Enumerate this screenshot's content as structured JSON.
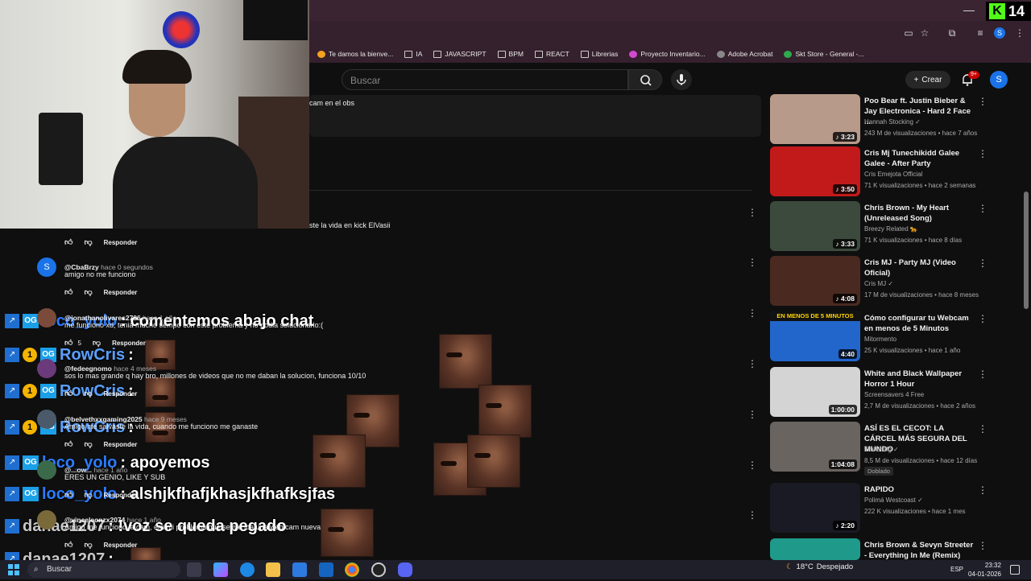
{
  "kick": {
    "viewer_count": "14",
    "logo_letter": "K"
  },
  "browser": {
    "minimize_glyph": "—",
    "bookmarks": [
      {
        "label": "Te damos la bienve...",
        "icon": "orange-logo-icon"
      },
      {
        "label": "IA",
        "icon": "folder-icon"
      },
      {
        "label": "JAVASCRIPT",
        "icon": "folder-icon"
      },
      {
        "label": "BPM",
        "icon": "folder-icon"
      },
      {
        "label": "REACT",
        "icon": "folder-icon"
      },
      {
        "label": "Librerias",
        "icon": "folder-icon"
      },
      {
        "label": "Proyecto Inventario...",
        "icon": "app-icon"
      },
      {
        "label": "Adobe Acrobat",
        "icon": "acrobat-icon"
      },
      {
        "label": "Skt Store - General -...",
        "icon": "store-icon"
      }
    ],
    "profile_letter": "S"
  },
  "youtube": {
    "search_placeholder": "Buscar",
    "create_label": "Crear",
    "notification_badge": "9+",
    "avatar_letter": "S"
  },
  "comments": {
    "top_snippet": "cam en el obs",
    "snippet2": "ste la vida en kick ElVasii",
    "reply_label": "Responder",
    "items": [
      {
        "user": "@CbaBrzy",
        "time": "hace 0 segundos",
        "text": "amigo no me funciono",
        "avatar_letter": "S",
        "likes": ""
      },
      {
        "user": "@jonathanolivares2706",
        "time": "hace 1 año",
        "text": "me funciono xd, tenia mucho tiempo con este problema y no podia solucionarlo:(",
        "likes": "5"
      },
      {
        "user": "@fedeegnomo",
        "time": "hace 4 meses",
        "text": "sos lo mas grande q hay bro, millones de videos que no me daban la solucion, funciona 10/10",
        "likes": ""
      },
      {
        "user": "@belvethxxgaming2025",
        "time": "hace 9 meses",
        "text": "Amigo me salvaste la vida, cuando me funciono me ganaste",
        "likes": ""
      },
      {
        "user": "@...ow...",
        "time": "hace 1 año",
        "text": "ERES UN GENIO, LIKE Y SUB",
        "likes": ""
      },
      {
        "user": "@vinceleonzx2074",
        "time": "hace 1 año",
        "text": "Amigo me funciono la cam, era mi problema que se me iba una web cam nueva",
        "likes": ""
      }
    ]
  },
  "chat": [
    {
      "name": "loco_yolo",
      "msg": ": comentemos abajo chat",
      "name_color": "#2b7cff",
      "badges": [
        "kick",
        "og"
      ]
    },
    {
      "name": "RowCris",
      "msg": ":",
      "name_color": "#5aa0ff",
      "badges": [
        "kick",
        "one",
        "og"
      ]
    },
    {
      "name": "RowCris",
      "msg": ":",
      "name_color": "#5aa0ff",
      "badges": [
        "kick",
        "one",
        "og"
      ]
    },
    {
      "name": "RowCris",
      "msg": ":",
      "name_color": "#5aa0ff",
      "badges": [
        "kick",
        "one",
        "og"
      ]
    },
    {
      "name": "loco_yolo",
      "msg": ": apoyemos",
      "name_color": "#2b7cff",
      "badges": [
        "kick",
        "og"
      ]
    },
    {
      "name": "loco_yolo",
      "msg": ": alshjkfhafjkhasjkfhafksjfas",
      "name_color": "#2b7cff",
      "badges": [
        "kick",
        "og"
      ]
    },
    {
      "name": "danae1207",
      "msg": ": !voz se queda pegado",
      "name_color": "#c8c8c8",
      "badges": [
        "kick"
      ]
    },
    {
      "name": "danae1207",
      "msg": ":",
      "name_color": "#c8c8c8",
      "badges": [
        "kick"
      ]
    }
  ],
  "sidebar": {
    "videos": [
      {
        "title": "Poo Bear ft. Justin Bieber & Jay Electronica - Hard 2 Face ...",
        "channel": "Hannah Stocking ✓",
        "meta": "243 M de visualizaciones • hace 7 años",
        "duration": "♪ 3:23",
        "thumb": "#b89a8a"
      },
      {
        "title": "Cris Mj Tunechikidd Galee Galee - After Party",
        "channel": "Cris Emejota Official",
        "meta": "71 K visualizaciones • hace 2 semanas",
        "duration": "♪ 3:50",
        "thumb": "#c21a1a"
      },
      {
        "title": "Chris Brown - My Heart (Unreleased Song)",
        "channel": "Breezy Related 🐆",
        "meta": "71 K visualizaciones • hace 8 días",
        "duration": "♪ 3:33",
        "thumb": "#3c4a3e"
      },
      {
        "title": "Cris MJ - Party MJ (Video Oficial)",
        "channel": "Cris MJ ✓",
        "meta": "17 M de visualizaciones • hace 8 meses",
        "duration": "♪ 4:08",
        "thumb": "#4a2a20"
      },
      {
        "title": "Cómo configurar tu Webcam en menos de 5 Minutos",
        "channel": "Mitormento",
        "meta": "25 K visualizaciones • hace 1 año",
        "duration": "4:40",
        "thumb": "#2266cc",
        "overlay": "EN MENOS DE 5 MINUTOS"
      },
      {
        "title": "White and Black Wallpaper Horror 1 Hour",
        "channel": "Screensavers 4 Free",
        "meta": "2,7 M de visualizaciones • hace 2 años",
        "duration": "1:00:00",
        "thumb": "#d4d4d4"
      },
      {
        "title": "ASÍ ES EL CECOT: LA CÁRCEL MÁS SEGURA DEL MUNDO",
        "channel": "TheGrefg ✓",
        "meta": "8,5 M de visualizaciones • hace 12 días",
        "duration": "1:04:08",
        "thumb": "#6a6460",
        "tag": "Doblado"
      },
      {
        "title": "RAPIDO",
        "channel": "Polimá Westcoast ✓",
        "meta": "222 K visualizaciones • hace 1 mes",
        "duration": "♪ 2:20",
        "thumb": "#1a1a24"
      },
      {
        "title": "Chris Brown & Sevyn Streeter - Everything In Me (Remix)",
        "channel": "",
        "meta": "",
        "duration": "",
        "thumb": "#1f9a8a"
      }
    ]
  },
  "taskbar": {
    "search_label": "Buscar",
    "temperature": "18°C",
    "weather": "Despejado",
    "language": "ESP",
    "time": "23:32",
    "date": "04-01-2026"
  }
}
